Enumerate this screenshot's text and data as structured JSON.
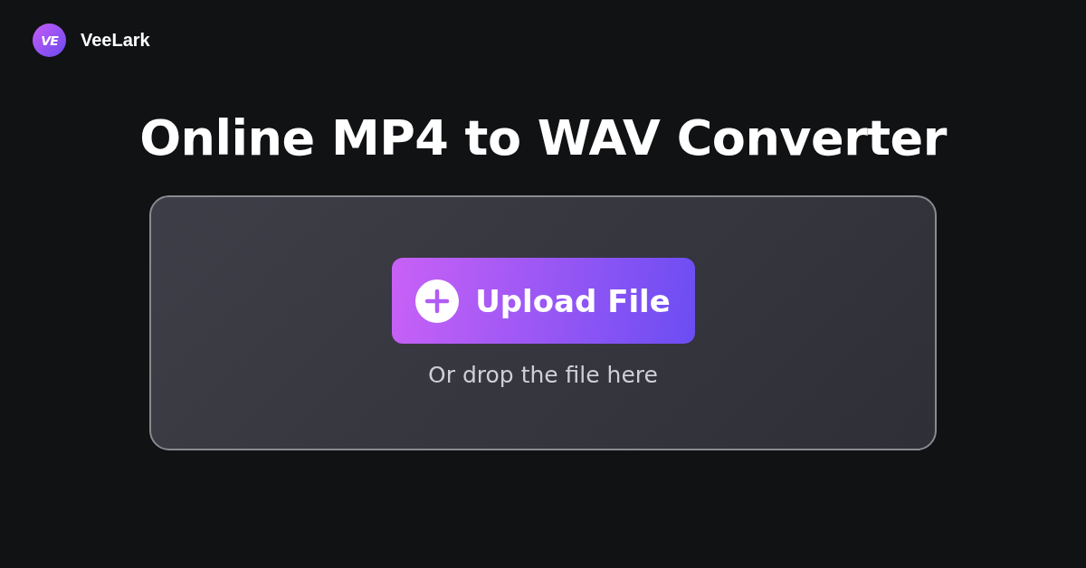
{
  "brand": {
    "mark": "VE",
    "name": "VeeLark"
  },
  "title": "Online MP4 to WAV Converter",
  "dropzone": {
    "button": "Upload File",
    "hint": "Or drop the file here"
  }
}
